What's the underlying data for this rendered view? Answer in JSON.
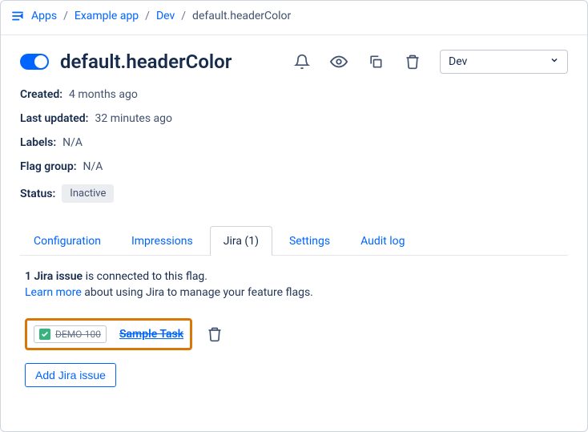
{
  "breadcrumb": {
    "items": [
      "Apps",
      "Example app",
      "Dev"
    ],
    "current": "default.headerColor"
  },
  "header": {
    "title": "default.headerColor",
    "env_selected": "Dev"
  },
  "meta": {
    "created_label": "Created:",
    "created_value": "4 months ago",
    "updated_label": "Last updated:",
    "updated_value": "32 minutes ago",
    "labels_label": "Labels:",
    "labels_value": "N/A",
    "group_label": "Flag group:",
    "group_value": "N/A",
    "status_label": "Status:",
    "status_value": "Inactive"
  },
  "tabs": {
    "items": [
      {
        "label": "Configuration"
      },
      {
        "label": "Impressions"
      },
      {
        "label": "Jira (1)"
      },
      {
        "label": "Settings"
      },
      {
        "label": "Audit log"
      }
    ],
    "active_index": 2
  },
  "jira": {
    "connected_bold": "1 Jira issue",
    "connected_rest": " is connected to this flag.",
    "learn_link": "Learn more",
    "learn_rest": " about using Jira to manage your feature flags.",
    "issue": {
      "key": "DEMO-100",
      "title": "Sample Task"
    },
    "add_button": "Add Jira issue"
  }
}
